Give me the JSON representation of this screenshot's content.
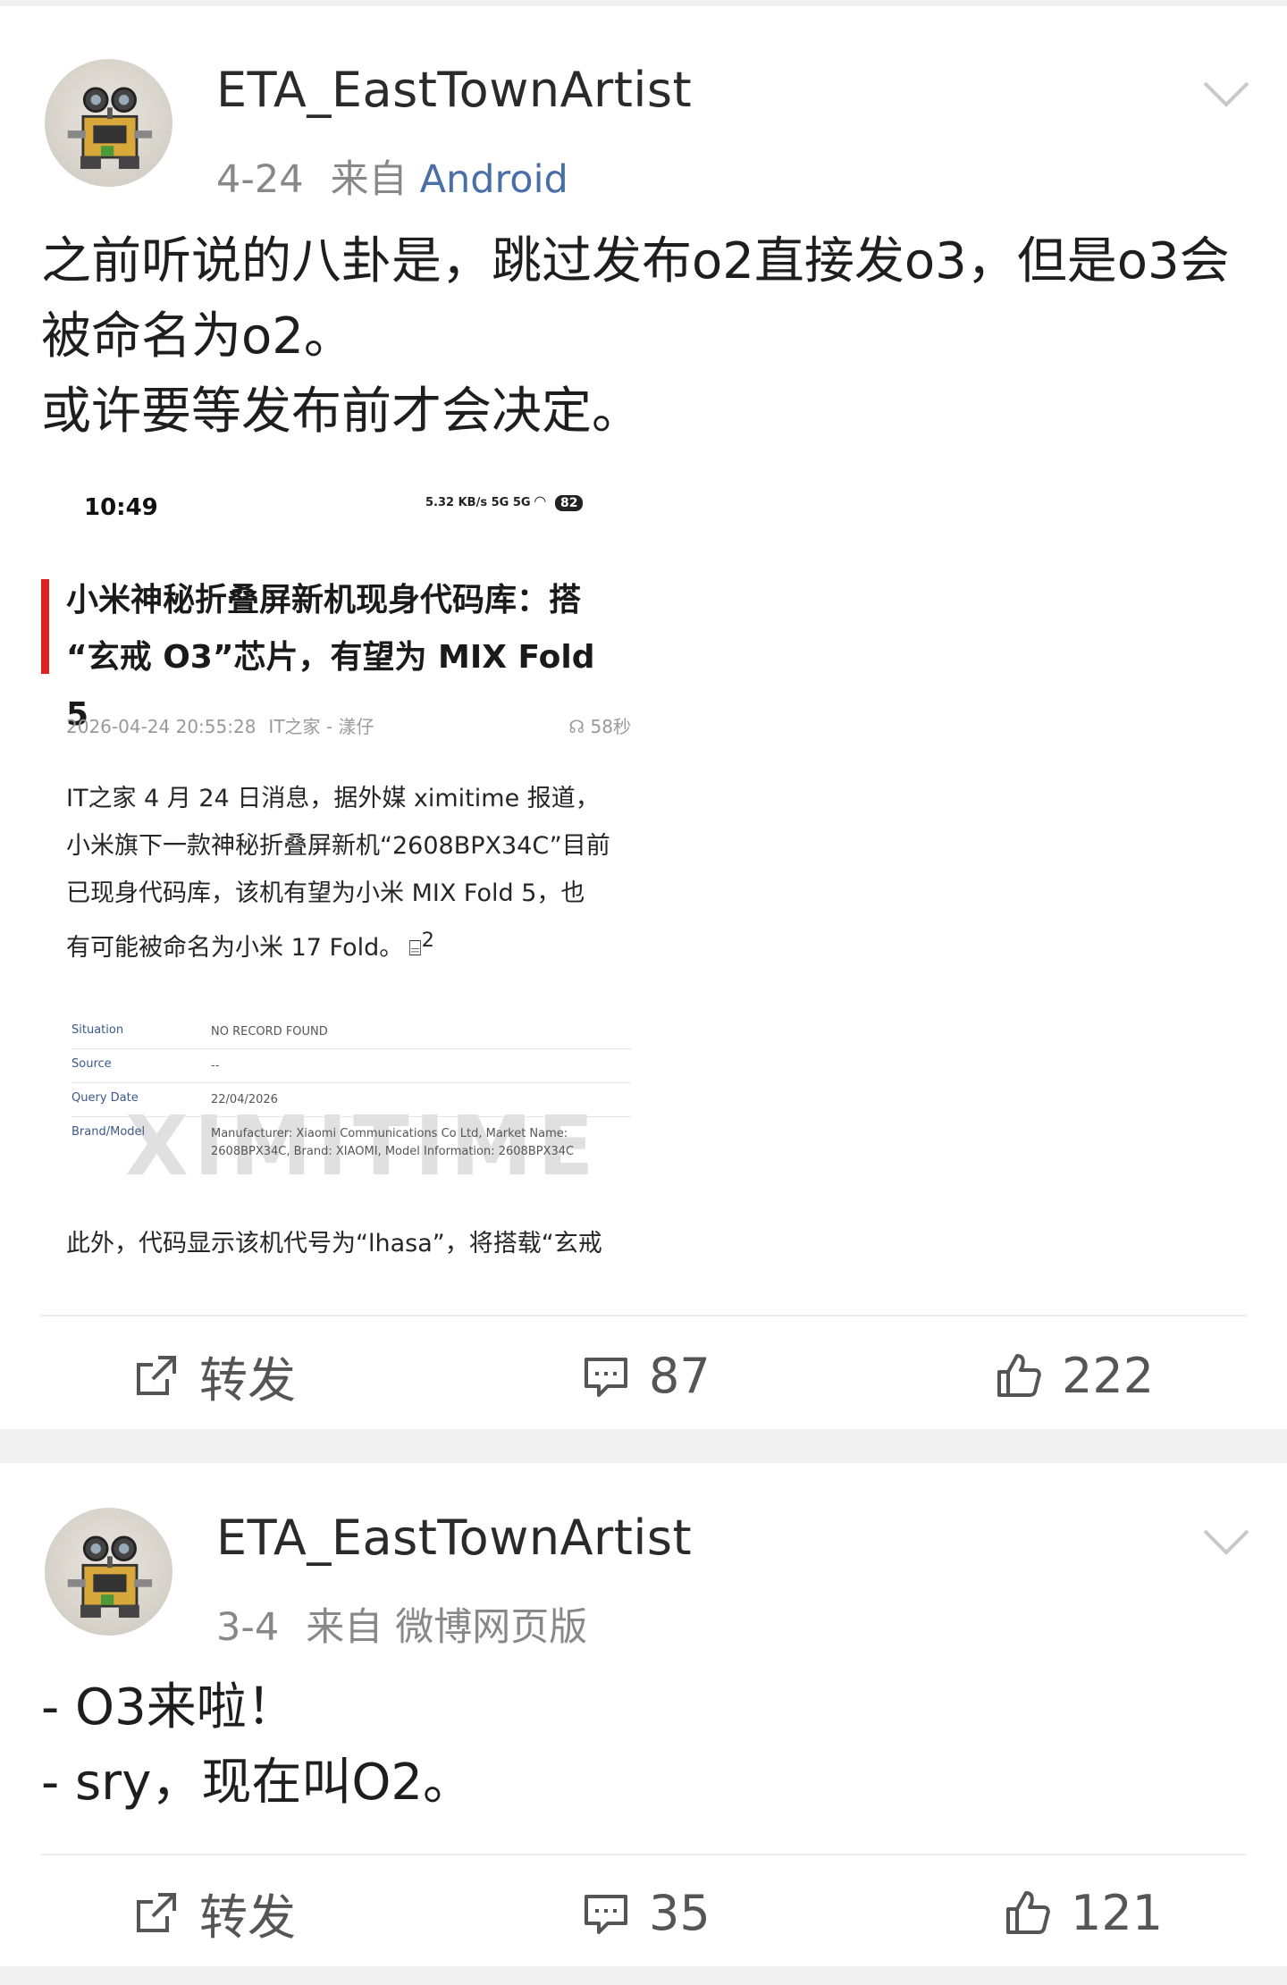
{
  "posts": [
    {
      "username": "ETA_EastTownArtist",
      "date": "4-24",
      "source_label": "来自",
      "source": "Android",
      "text_lines": [
        "之前听说的八卦是，跳过发布o2直接发o3，但是o3会",
        "被命名为o2。",
        "或许要等发布前才会决定。"
      ],
      "embedded_screenshot": {
        "time": "10:49",
        "status_speed": "5.32 KB/s",
        "status_signal": "5G 5G",
        "battery": "82",
        "article_title_line1": "小米神秘折叠屏新机现身代码库：搭",
        "article_title_line2": "“玄戒 O3”芯片，有望为 MIX Fold 5",
        "publish_time": "2026-04-24 20:55:28",
        "publish_source": "IT之家 - 漾仔",
        "listen_duration": "58秒",
        "paragraph_lines": [
          "IT之家 4 月 24 日消息，据外媒 ximitime 报道，",
          "小米旗下一款神秘折叠屏新机“2608BPX34C”目前",
          "已现身代码库，该机有望为小米 MIX Fold 5，也",
          "有可能被命名为小米 17 Fold。"
        ],
        "comment_count_badge": "2",
        "table": [
          {
            "key": "Situation",
            "value": "NO RECORD FOUND"
          },
          {
            "key": "Source",
            "value": "--"
          },
          {
            "key": "Query Date",
            "value": "22/04/2026"
          },
          {
            "key": "Brand/Model",
            "value": "Manufacturer: Xiaomi Communications Co Ltd, Market Name: 2608BPX34C, Brand: XIAOMI, Model Information: 2608BPX34C"
          }
        ],
        "watermark": "XIMITIME",
        "paragraph2": "此外，代码显示该机代号为“lhasa”，将搭载“玄戒"
      },
      "repost_label": "转发",
      "comments": "87",
      "likes": "222"
    },
    {
      "username": "ETA_EastTownArtist",
      "date": "3-4",
      "source_label": "来自",
      "source": "微博网页版",
      "text_lines": [
        "- O3来啦！",
        "- sry，现在叫O2。"
      ],
      "repost_label": "转发",
      "comments": "35",
      "likes": "121"
    }
  ],
  "icons": {
    "menu": "chevron-down-icon",
    "repost": "share-square-icon",
    "comment": "comment-bubble-icon",
    "like": "thumbs-up-icon"
  },
  "colors": {
    "source_link": "#4a6fa8",
    "accent_bar": "#d22222",
    "background": "#f0f0f0"
  }
}
